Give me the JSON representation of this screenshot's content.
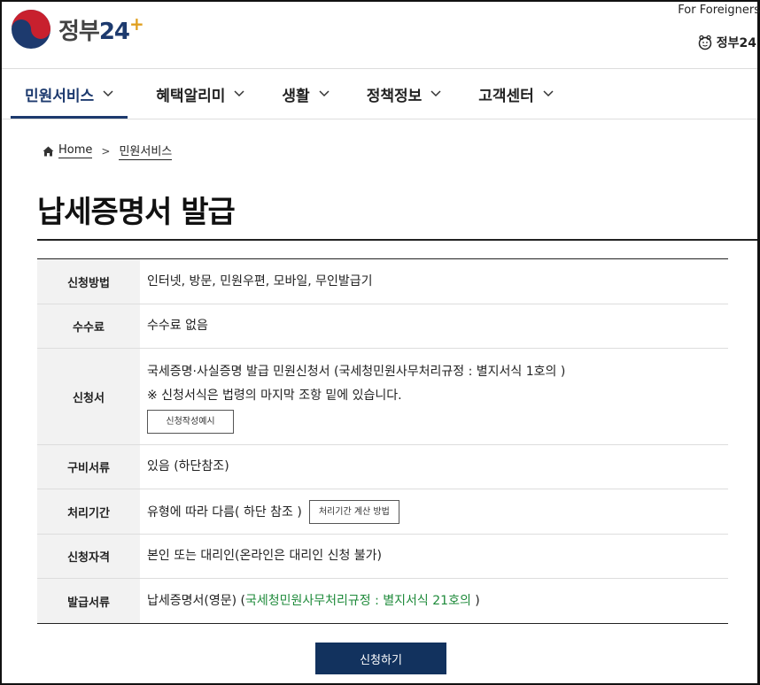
{
  "header": {
    "logo_text": "정부",
    "logo_num": "24",
    "logo_plus": "+",
    "foreigners_link": "For Foreigners",
    "gov_link": "정부24"
  },
  "nav": {
    "items": [
      {
        "label": "민원서비스"
      },
      {
        "label": "혜택알리미"
      },
      {
        "label": "생활"
      },
      {
        "label": "정책정보"
      },
      {
        "label": "고객센터"
      }
    ],
    "active_index": 0
  },
  "breadcrumb": {
    "home": "Home",
    "current": "민원서비스"
  },
  "page_title": "납세증명서 발급",
  "info": {
    "method": {
      "label": "신청방법",
      "value": "인터넷, 방문, 민원우편, 모바일, 무인발급기"
    },
    "fee": {
      "label": "수수료",
      "value": "수수료 없음"
    },
    "form": {
      "label": "신청서",
      "line1": "국세증명·사실증명 발급 민원신청서 (국세청민원사무처리규정 : 별지서식 1호의 )",
      "line2": "※ 신청서식은 법령의 마지막 조항 밑에 있습니다.",
      "example_button": "신청작성예시"
    },
    "docs": {
      "label": "구비서류",
      "value": "있음 (하단참조)"
    },
    "period": {
      "label": "처리기간",
      "value": "유형에 따라 다름( 하단 참조 )",
      "calc_button": "처리기간 계산 방법"
    },
    "eligibility": {
      "label": "신청자격",
      "value": "본인 또는 대리인(온라인은 대리인 신청 불가)"
    },
    "output": {
      "label": "발급서류",
      "value_prefix": "납세증명서(영문) (",
      "value_green": "국세청민원사무처리규정 : 별지서식 21호의",
      "value_suffix": " )"
    }
  },
  "apply_button": "신청하기",
  "colors": {
    "primary": "#12325e",
    "active_nav": "#1d3a6e",
    "green": "#1e8a3a"
  }
}
